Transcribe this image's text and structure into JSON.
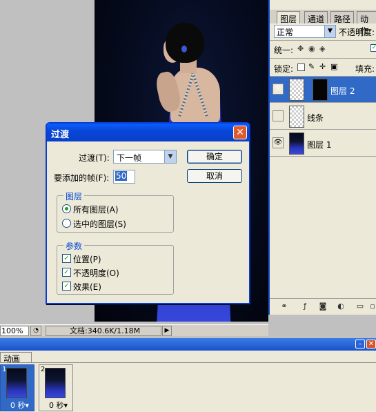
{
  "dialog": {
    "title": "过渡",
    "close_glyph": "✕",
    "tween_label": "过渡(T):",
    "tween_value": "下一帧",
    "frames_label": "要添加的帧(F):",
    "frames_value": "50",
    "ok_label": "确定",
    "cancel_label": "取消",
    "layers_group": {
      "title": "图层",
      "options": [
        {
          "label": "所有图层(A)",
          "checked": true
        },
        {
          "label": "选中的图层(S)",
          "checked": false
        }
      ]
    },
    "params_group": {
      "title": "参数",
      "options": [
        {
          "label": "位置(P)",
          "checked": true
        },
        {
          "label": "不透明度(O)",
          "checked": true
        },
        {
          "label": "效果(E)",
          "checked": true
        }
      ]
    }
  },
  "layers_panel": {
    "tabs": [
      "图层",
      "通道",
      "路径",
      "动作"
    ],
    "blend_mode": "正常",
    "opacity_label": "不透明度:",
    "unify_label": "统一:",
    "lock_label": "锁定:",
    "fill_label": "填充:",
    "layers": [
      {
        "name": "图层 2",
        "visible": true,
        "selected": true
      },
      {
        "name": "线条",
        "visible": false,
        "selected": false
      },
      {
        "name": "图层 1",
        "visible": true,
        "selected": false
      }
    ]
  },
  "status_bar": {
    "zoom": "100%",
    "doc_info": "文档:340.6K/1.18M"
  },
  "animation_panel": {
    "tab_label": "动画",
    "frames": [
      {
        "number": "1",
        "delay": "0 秒▾",
        "selected": true
      },
      {
        "number": "2",
        "delay": "0 秒▾",
        "selected": false
      }
    ]
  },
  "icons": {
    "eye": "👁",
    "check": "✓",
    "dropdown": "▼",
    "play": "▶"
  },
  "colors": {
    "title_blue": "#0846d8",
    "selection_blue": "#3169c6",
    "dress_blue": "#2a34b8"
  }
}
